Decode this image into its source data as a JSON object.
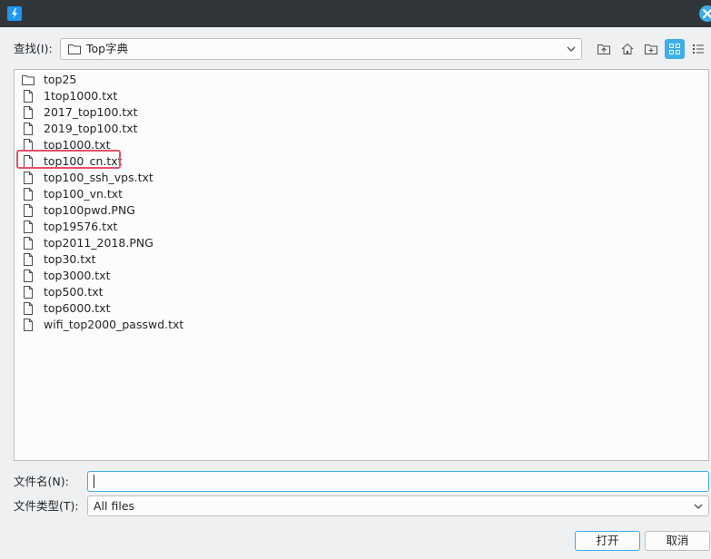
{
  "dialog": {
    "look_in_label": "查找(I):",
    "current_folder": "Top字典",
    "filename_label": "文件名(N):",
    "filename_value": "",
    "filetype_label": "文件类型(T):",
    "filetype_value": "All files",
    "open_label": "打开",
    "cancel_label": "取消"
  },
  "toolbar": {
    "icons": [
      "folder-up-icon",
      "home-icon",
      "new-folder-icon",
      "icon-view-icon",
      "list-view-icon"
    ],
    "active_view": "icon-view"
  },
  "files": [
    {
      "name": "top25",
      "type": "folder"
    },
    {
      "name": "1top1000.txt",
      "type": "file"
    },
    {
      "name": "2017_top100.txt",
      "type": "file"
    },
    {
      "name": "2019_top100.txt",
      "type": "file"
    },
    {
      "name": "top1000.txt",
      "type": "file"
    },
    {
      "name": "top100_cn.txt",
      "type": "file",
      "highlighted": true
    },
    {
      "name": "top100_ssh_vps.txt",
      "type": "file"
    },
    {
      "name": "top100_vn.txt",
      "type": "file"
    },
    {
      "name": "top100pwd.PNG",
      "type": "file"
    },
    {
      "name": "top19576.txt",
      "type": "file"
    },
    {
      "name": "top2011_2018.PNG",
      "type": "file"
    },
    {
      "name": "top30.txt",
      "type": "file"
    },
    {
      "name": "top3000.txt",
      "type": "file"
    },
    {
      "name": "top500.txt",
      "type": "file"
    },
    {
      "name": "top6000.txt",
      "type": "file"
    },
    {
      "name": "wifi_top2000_passwd.txt",
      "type": "file"
    }
  ],
  "colors": {
    "titlebar": "#31363b",
    "accent": "#3daee9",
    "highlight_box": "#e5506a"
  }
}
